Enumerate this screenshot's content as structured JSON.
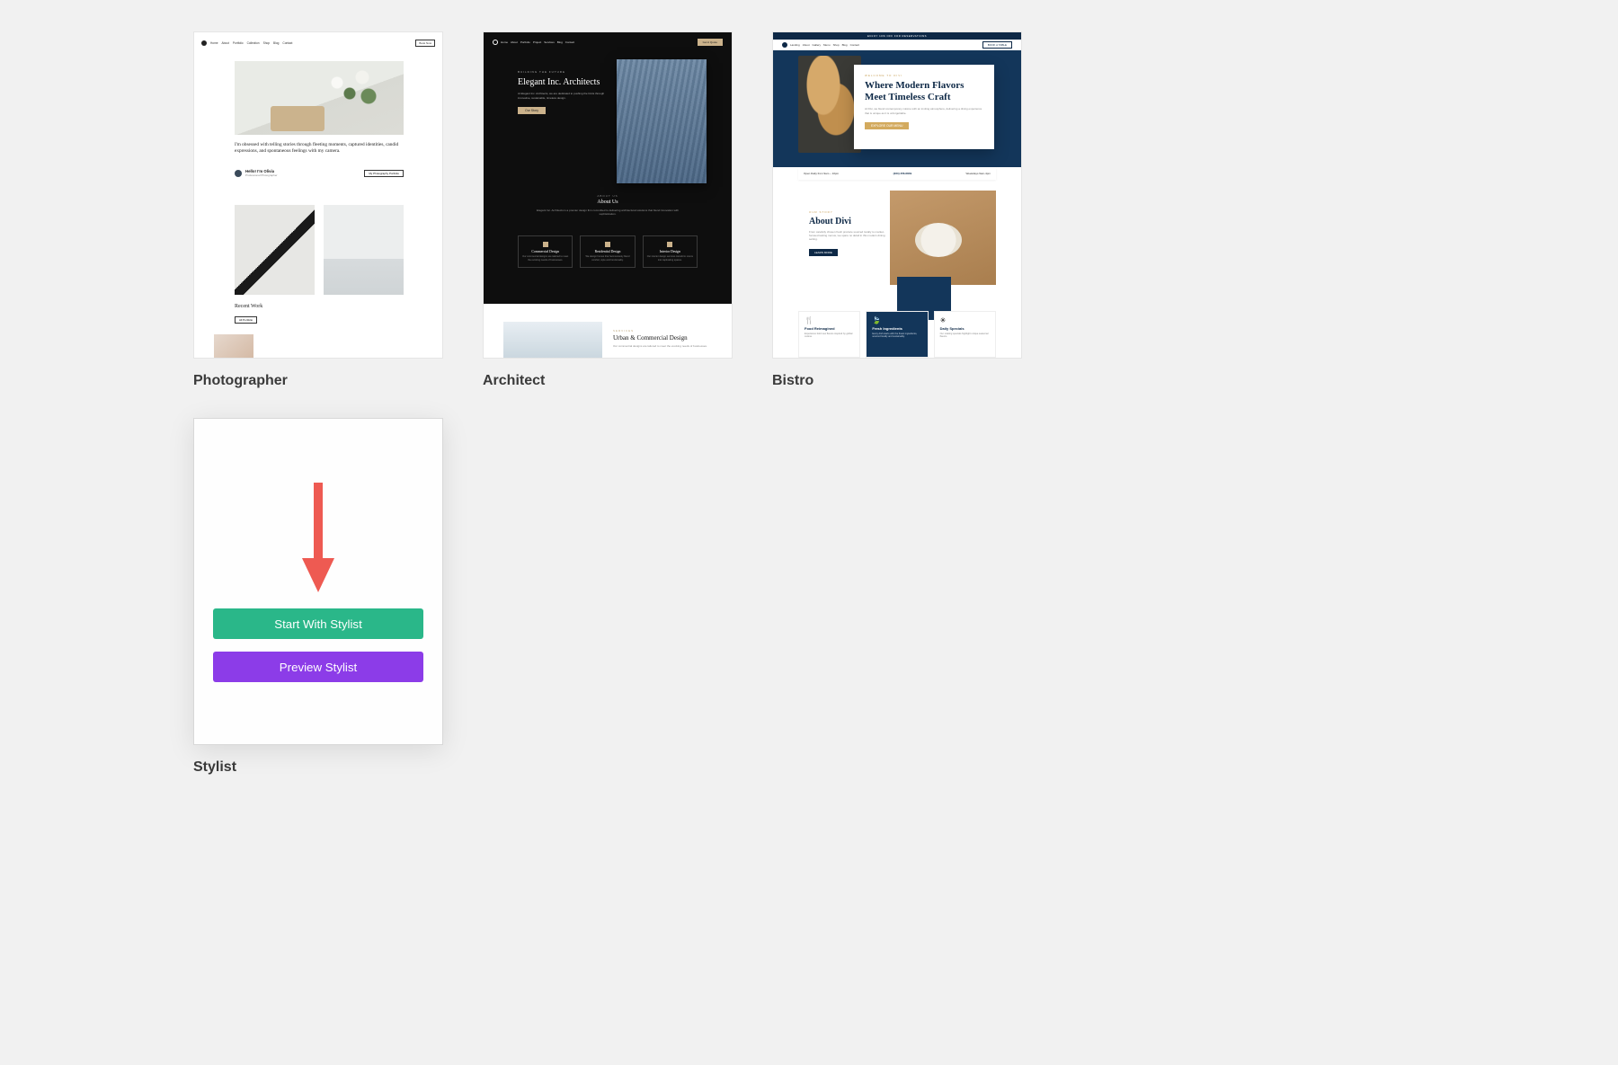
{
  "templates": [
    {
      "id": "photographer",
      "title": "Photographer"
    },
    {
      "id": "architect",
      "title": "Architect"
    },
    {
      "id": "bistro",
      "title": "Bistro"
    },
    {
      "id": "stylist",
      "title": "Stylist"
    }
  ],
  "stylist_hover": {
    "start_label": "Start With Stylist",
    "preview_label": "Preview Stylist"
  },
  "photographer_preview": {
    "nav": [
      "Home",
      "About",
      "Portfolio",
      "Collection",
      "Shop",
      "Blog",
      "Contact"
    ],
    "nav_cta": "Book Now",
    "tagline": "I'm obsessed with telling stories through fleeting moments, captured identities, candid expressions, and spontaneous feelings with my camera.",
    "byline_name": "Hello! I'm Olivia",
    "byline_sub": "Professional Photographer",
    "byline_cta": "My Photography Portfolio",
    "section": "Recent Work",
    "section_cta": "All Portfolio"
  },
  "architect_preview": {
    "nav": [
      "Home",
      "About",
      "Portfolio",
      "Project",
      "Services",
      "Blog",
      "Contact"
    ],
    "nav_cta": "Get A Quote",
    "eyebrow": "BUILDING THE FUTURE",
    "heading": "Elegant Inc. Architects",
    "about_eyebrow": "ABOUT US",
    "about_heading": "About Us",
    "boxes": [
      {
        "title": "Commercial Design"
      },
      {
        "title": "Residential Design"
      },
      {
        "title": "Interior Design"
      }
    ],
    "light_eyebrow": "SERVICES",
    "light_heading": "Urban & Commercial Design"
  },
  "bistro_preview": {
    "announcement": "ENJOY 10% OFF FOR RESERVATIONS",
    "nav": [
      "Landing",
      "About",
      "Gallery",
      "Menu",
      "Shop",
      "Blog",
      "Contact"
    ],
    "nav_cta": "BOOK A TABLE",
    "hero_eyebrow": "WELCOME TO DIVI",
    "hero_heading": "Where Modern Flavors Meet Timeless Craft",
    "hero_cta": "EXPLORE OUR MENU",
    "strip": {
      "left_label": "Open Daily from 9am – 10pm",
      "mid": "(234) 456-6849",
      "right": "Weekdays 9am-4pm"
    },
    "about_eyebrow": "OUR STORY",
    "about_heading": "About Divi",
    "about_cta": "LEARN MORE",
    "features": [
      {
        "title": "Food Reimagined"
      },
      {
        "title": "Fresh Ingredients"
      },
      {
        "title": "Daily Specials"
      }
    ]
  }
}
